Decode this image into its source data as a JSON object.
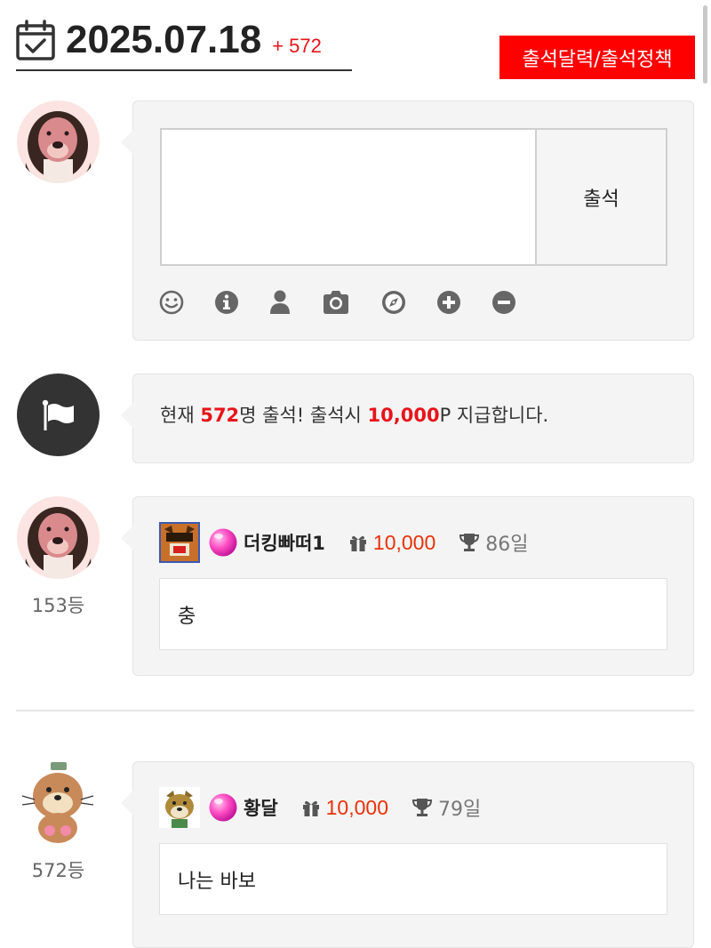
{
  "header": {
    "date": "2025.07.18",
    "count": "+ 572",
    "policy_button": "출석달력/출석정책",
    "icon": "calendar-check-icon"
  },
  "compose": {
    "input_value": "",
    "submit_label": "출석",
    "tools": [
      {
        "name": "emoticon-icon"
      },
      {
        "name": "info-icon"
      },
      {
        "name": "user-icon"
      },
      {
        "name": "camera-icon"
      },
      {
        "name": "compass-icon"
      },
      {
        "name": "plus-circle-icon"
      },
      {
        "name": "minus-circle-icon"
      }
    ]
  },
  "info": {
    "prefix": "현재 ",
    "count": "572",
    "middle": "명 출석! 출석시 ",
    "points": "10,000",
    "suffix": "P 지급합니다.",
    "icon": "flag-icon"
  },
  "entries": [
    {
      "rank": "153등",
      "nickname": "더킹빠떠1",
      "points": "10,000",
      "days": "86일",
      "comment": "충"
    },
    {
      "rank": "572등",
      "nickname": "황달",
      "points": "10,000",
      "days": "79일",
      "comment": "나는 바보"
    }
  ],
  "colors": {
    "accent_red": "#e8141b",
    "policy_button_bg": "#ff0000",
    "point_orange": "#e8320a",
    "bubble_bg": "#f4f4f4",
    "flag_circle": "#333333"
  }
}
